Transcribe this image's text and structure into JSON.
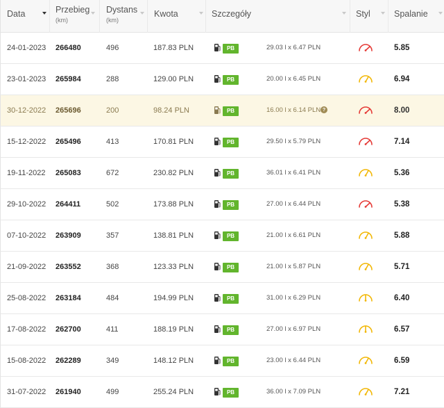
{
  "colors": {
    "green_badge": "#62b52d",
    "gauge_red": "#e53935",
    "gauge_yellow": "#f2b705",
    "highlight_row": "#fcf7e4"
  },
  "header": {
    "date": "Data",
    "mileage": "Przebieg",
    "mileage_unit": "(km)",
    "distance": "Dystans",
    "distance_unit": "(km)",
    "amount": "Kwota",
    "details": "Szczegóły",
    "style": "Styl",
    "consumption": "Spalanie"
  },
  "rows": [
    {
      "date": "24-01-2023",
      "mileage": "266480",
      "distance": "496",
      "amount": "187.83 PLN",
      "fuel": "PB",
      "detail": "29.03 l x 6.47 PLN",
      "style": "aggressive-gauge-icon",
      "consumption": "5.85",
      "highlight": false,
      "help": false
    },
    {
      "date": "23-01-2023",
      "mileage": "265984",
      "distance": "288",
      "amount": "129.00 PLN",
      "fuel": "PB",
      "detail": "20.00 l x 6.45 PLN",
      "style": "normal-gauge-icon",
      "consumption": "6.94",
      "highlight": false,
      "help": false
    },
    {
      "date": "30-12-2022",
      "mileage": "265696",
      "distance": "200",
      "amount": "98.24 PLN",
      "fuel": "PB",
      "detail": "16.00 l x 6.14 PLN",
      "style": "aggressive-gauge-icon",
      "consumption": "8.00",
      "highlight": true,
      "help": true
    },
    {
      "date": "15-12-2022",
      "mileage": "265496",
      "distance": "413",
      "amount": "170.81 PLN",
      "fuel": "PB",
      "detail": "29.50 l x 5.79 PLN",
      "style": "aggressive-gauge-icon",
      "consumption": "7.14",
      "highlight": false,
      "help": false
    },
    {
      "date": "19-11-2022",
      "mileage": "265083",
      "distance": "672",
      "amount": "230.82 PLN",
      "fuel": "PB",
      "detail": "36.01 l x 6.41 PLN",
      "style": "normal-gauge-icon",
      "consumption": "5.36",
      "highlight": false,
      "help": false
    },
    {
      "date": "29-10-2022",
      "mileage": "264411",
      "distance": "502",
      "amount": "173.88 PLN",
      "fuel": "PB",
      "detail": "27.00 l x 6.44 PLN",
      "style": "aggressive-gauge-icon",
      "consumption": "5.38",
      "highlight": false,
      "help": false
    },
    {
      "date": "07-10-2022",
      "mileage": "263909",
      "distance": "357",
      "amount": "138.81 PLN",
      "fuel": "PB",
      "detail": "21.00 l x 6.61 PLN",
      "style": "normal-gauge-icon",
      "consumption": "5.88",
      "highlight": false,
      "help": false
    },
    {
      "date": "21-09-2022",
      "mileage": "263552",
      "distance": "368",
      "amount": "123.33 PLN",
      "fuel": "PB",
      "detail": "21.00 l x 5.87 PLN",
      "style": "normal-gauge-icon",
      "consumption": "5.71",
      "highlight": false,
      "help": false
    },
    {
      "date": "25-08-2022",
      "mileage": "263184",
      "distance": "484",
      "amount": "194.99 PLN",
      "fuel": "PB",
      "detail": "31.00 l x 6.29 PLN",
      "style": "eco-gauge-icon",
      "consumption": "6.40",
      "highlight": false,
      "help": false
    },
    {
      "date": "17-08-2022",
      "mileage": "262700",
      "distance": "411",
      "amount": "188.19 PLN",
      "fuel": "PB",
      "detail": "27.00 l x 6.97 PLN",
      "style": "eco-gauge-icon",
      "consumption": "6.57",
      "highlight": false,
      "help": false
    },
    {
      "date": "15-08-2022",
      "mileage": "262289",
      "distance": "349",
      "amount": "148.12 PLN",
      "fuel": "PB",
      "detail": "23.00 l x 6.44 PLN",
      "style": "normal-gauge-icon",
      "consumption": "6.59",
      "highlight": false,
      "help": false
    },
    {
      "date": "31-07-2022",
      "mileage": "261940",
      "distance": "499",
      "amount": "255.24 PLN",
      "fuel": "PB",
      "detail": "36.00 l x 7.09 PLN",
      "style": "normal-gauge-icon",
      "consumption": "7.21",
      "highlight": false,
      "help": false
    }
  ]
}
